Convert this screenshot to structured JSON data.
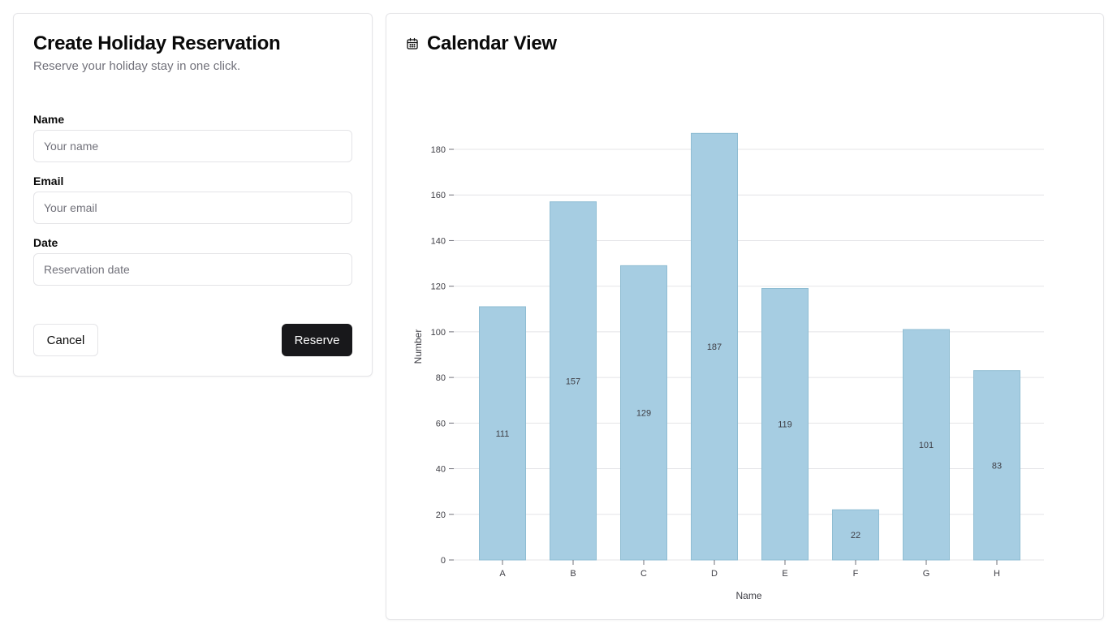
{
  "form": {
    "title": "Create Holiday Reservation",
    "description": "Reserve your holiday stay in one click.",
    "fields": {
      "name": {
        "label": "Name",
        "placeholder": "Your name",
        "value": ""
      },
      "email": {
        "label": "Email",
        "placeholder": "Your email",
        "value": ""
      },
      "date": {
        "label": "Date",
        "placeholder": "Reservation date",
        "value": ""
      }
    },
    "cancel_label": "Cancel",
    "reserve_label": "Reserve"
  },
  "chart_panel": {
    "title": "Calendar View",
    "icon": "calendar-icon"
  },
  "colors": {
    "bar_fill": "#a6cde2",
    "bar_stroke": "#8fbdd3",
    "primary_button": "#18181b",
    "border": "#e4e4e7"
  },
  "chart_data": {
    "type": "bar",
    "categories": [
      "A",
      "B",
      "C",
      "D",
      "E",
      "F",
      "G",
      "H"
    ],
    "values": [
      111,
      157,
      129,
      187,
      119,
      22,
      101,
      83
    ],
    "title": "",
    "xlabel": "Name",
    "ylabel": "Number",
    "ylim": [
      0,
      180
    ],
    "yticks": [
      0,
      20,
      40,
      60,
      80,
      100,
      120,
      140,
      160,
      180
    ],
    "grid": true,
    "data_labels": true
  }
}
